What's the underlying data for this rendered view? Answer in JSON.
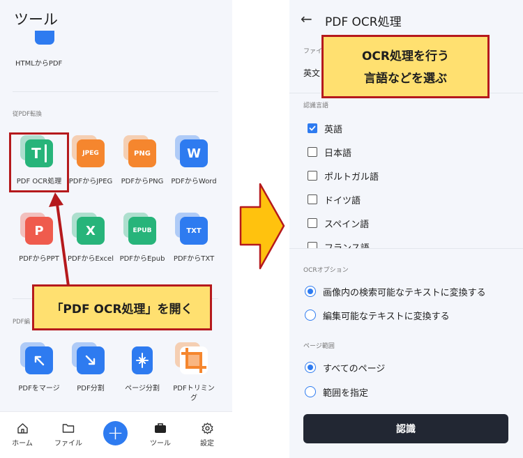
{
  "left": {
    "title": "ツール",
    "html_to_pdf_label": "HTMLからPDF",
    "section_convert": "従PDF転換",
    "convert_tools": [
      {
        "label": "PDF OCR処理",
        "icon": "ocr-icon",
        "glyph": "T",
        "color": "#27b47a"
      },
      {
        "label": "PDFからJPEG",
        "icon": "jpeg-icon",
        "glyph": "JPEG",
        "color": "#f5862e"
      },
      {
        "label": "PDFからPNG",
        "icon": "png-icon",
        "glyph": "PNG",
        "color": "#f5862e"
      },
      {
        "label": "PDFからWord",
        "icon": "word-icon",
        "glyph": "W",
        "color": "#2e7bf0"
      },
      {
        "label": "PDFからPPT",
        "icon": "ppt-icon",
        "glyph": "P",
        "color": "#ef5b4d"
      },
      {
        "label": "PDFからExcel",
        "icon": "excel-icon",
        "glyph": "X",
        "color": "#27b47a"
      },
      {
        "label": "PDFからEpub",
        "icon": "epub-icon",
        "glyph": "EPUB",
        "color": "#27b47a"
      },
      {
        "label": "PDFからTXT",
        "icon": "txt-icon",
        "glyph": "TXT",
        "color": "#2e7bf0"
      }
    ],
    "section_edit": "PDF編",
    "edit_tools": [
      {
        "label": "PDFをマージ",
        "icon": "merge-icon",
        "color": "#2e7bf0"
      },
      {
        "label": "PDF分割",
        "icon": "split-icon",
        "color": "#2e7bf0"
      },
      {
        "label": "ページ分割",
        "icon": "page-split-icon",
        "color": "#2e7bf0"
      },
      {
        "label_line1": "PDFトリミン",
        "label_line2": "グ",
        "icon": "crop-icon",
        "color": "#f5862e"
      }
    ],
    "callout": "「PDF OCR処理」を開く",
    "nav": [
      {
        "label": "ホーム",
        "icon": "home-icon"
      },
      {
        "label": "ファイル",
        "icon": "folder-icon"
      },
      {
        "label": "ツール",
        "icon": "toolbox-icon"
      },
      {
        "label": "設定",
        "icon": "gear-icon"
      }
    ],
    "fab_glyph": "+"
  },
  "right": {
    "back_glyph": "←",
    "title": "PDF OCR処理",
    "file_label": "ファイ",
    "file_name": "英文",
    "section_language": "認識言語",
    "languages": [
      {
        "label": "英語",
        "checked": true
      },
      {
        "label": "日本語",
        "checked": false
      },
      {
        "label": "ポルトガル語",
        "checked": false
      },
      {
        "label": "ドイツ語",
        "checked": false
      },
      {
        "label": "スペイン語",
        "checked": false
      },
      {
        "label": "フランス語",
        "checked": false
      }
    ],
    "section_ocr": "OCRオプション",
    "ocr_options": [
      {
        "label": "画像内の検索可能なテキストに変換する",
        "selected": true
      },
      {
        "label": "編集可能なテキストに変換する",
        "selected": false
      }
    ],
    "section_page": "ページ範囲",
    "page_options": [
      {
        "label": "すべてのページ",
        "selected": true
      },
      {
        "label": "範囲を指定",
        "selected": false
      }
    ],
    "button": "認識",
    "callout_line1": "OCR処理を行う",
    "callout_line2": "言語などを選ぶ"
  },
  "colors": {
    "accent": "#2e7bf0",
    "callout_bg": "#ffe070",
    "callout_border": "#b5191c",
    "arrow_fill": "#ffc20e"
  }
}
